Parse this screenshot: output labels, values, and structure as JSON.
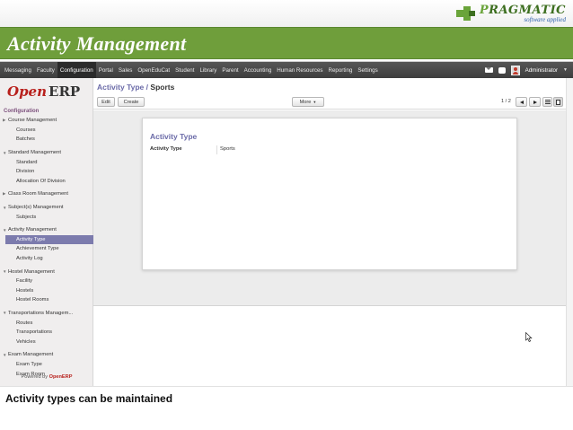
{
  "slide": {
    "title": "Activity Management",
    "caption": "Activity types can be maintained",
    "logo": {
      "brand_lead": "P",
      "brand_rest": "RAGMATIC",
      "tagline": "software applied"
    }
  },
  "topnav": {
    "items": [
      "Messaging",
      "Faculty",
      "Configuration",
      "Portal",
      "Sales",
      "OpenEduCat",
      "Student",
      "Library",
      "Parent",
      "Accounting",
      "Human Resources",
      "Reporting",
      "Settings"
    ],
    "active": "Configuration",
    "user": "Administrator"
  },
  "sidebar": {
    "logo_open": "Open",
    "logo_erp": "ERP",
    "section": "Configuration",
    "groups": [
      {
        "label": "Course Management",
        "expanded": false,
        "items": [
          "Courses",
          "Batches"
        ]
      },
      {
        "label": "Standard Management",
        "expanded": true,
        "items": [
          "Standard",
          "Division",
          "Allocation Of Division"
        ]
      },
      {
        "label": "Class Room Management",
        "expanded": false,
        "items": []
      },
      {
        "label": "Subject(s) Management",
        "expanded": true,
        "items": [
          "Subjects"
        ]
      },
      {
        "label": "Activity Management",
        "expanded": true,
        "items": [
          "Activity Type",
          "Achievement Type",
          "Activity Log"
        ]
      },
      {
        "label": "Hostel Management",
        "expanded": true,
        "items": [
          "Facility",
          "Hostels",
          "Hostel Rooms"
        ]
      },
      {
        "label": "Transportations Managem...",
        "expanded": true,
        "items": [
          "Routes",
          "Transportations",
          "Vehicles"
        ]
      },
      {
        "label": "Exam Management",
        "expanded": true,
        "items": [
          "Exam Type",
          "Exam Room"
        ]
      }
    ],
    "selected": "Activity Type",
    "powered_prefix": "Powered by",
    "powered_brand": "OpenERP"
  },
  "main": {
    "breadcrumb_parent": "Activity Type",
    "breadcrumb_sep": "/",
    "breadcrumb_current": "Sports",
    "edit_label": "Edit",
    "create_label": "Create",
    "more_label": "More",
    "pager": "1 / 2",
    "form": {
      "title": "Activity Type",
      "field_label": "Activity Type",
      "field_value": "Sports"
    }
  },
  "colors": {
    "title_bar": "#6f9e3b",
    "nav_bar": "#4a4a4a",
    "selected_item": "#7c7bad",
    "accent_link": "#6b6ba8",
    "openerp_red": "#b8201c"
  }
}
